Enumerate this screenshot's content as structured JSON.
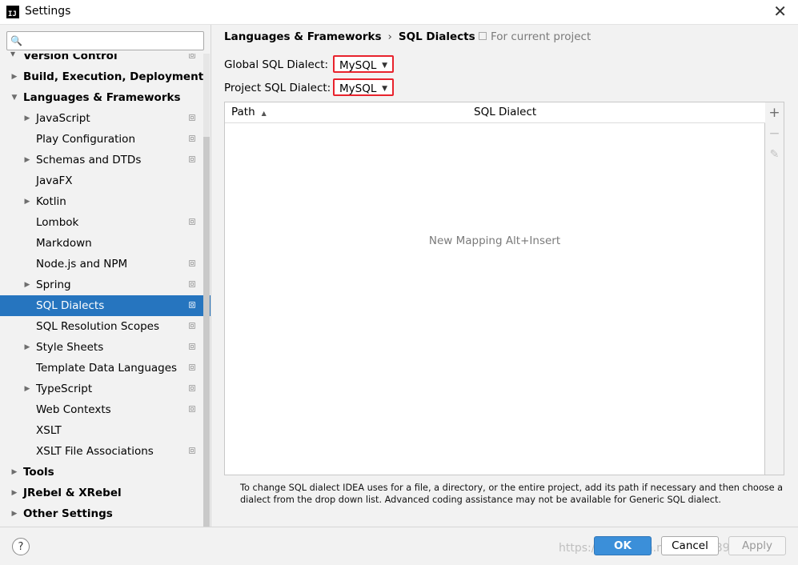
{
  "window": {
    "title": "Settings",
    "app_icon": "IJ",
    "close": "✕"
  },
  "search": {
    "icon": "search-icon",
    "placeholder": "",
    "value": ""
  },
  "tree": [
    {
      "label": "Version Control",
      "bold": true,
      "arrow": "",
      "indent": 0,
      "proj": true,
      "cut": true
    },
    {
      "label": "Build, Execution, Deployment",
      "bold": true,
      "arrow": "▶",
      "indent": 0,
      "proj": false
    },
    {
      "label": "Languages & Frameworks",
      "bold": true,
      "arrow": "▼",
      "indent": 0,
      "proj": false
    },
    {
      "label": "JavaScript",
      "arrow": "▶",
      "indent": 1,
      "proj": true
    },
    {
      "label": "Play Configuration",
      "arrow": "",
      "indent": 1,
      "proj": true
    },
    {
      "label": "Schemas and DTDs",
      "arrow": "▶",
      "indent": 1,
      "proj": true
    },
    {
      "label": "JavaFX",
      "arrow": "",
      "indent": 1,
      "proj": false
    },
    {
      "label": "Kotlin",
      "arrow": "▶",
      "indent": 1,
      "proj": false
    },
    {
      "label": "Lombok",
      "arrow": "",
      "indent": 1,
      "proj": true
    },
    {
      "label": "Markdown",
      "arrow": "",
      "indent": 1,
      "proj": false
    },
    {
      "label": "Node.js and NPM",
      "arrow": "",
      "indent": 1,
      "proj": true
    },
    {
      "label": "Spring",
      "arrow": "▶",
      "indent": 1,
      "proj": true
    },
    {
      "label": "SQL Dialects",
      "arrow": "",
      "indent": 1,
      "proj": true,
      "selected": true
    },
    {
      "label": "SQL Resolution Scopes",
      "arrow": "",
      "indent": 1,
      "proj": true
    },
    {
      "label": "Style Sheets",
      "arrow": "▶",
      "indent": 1,
      "proj": true
    },
    {
      "label": "Template Data Languages",
      "arrow": "",
      "indent": 1,
      "proj": true
    },
    {
      "label": "TypeScript",
      "arrow": "▶",
      "indent": 1,
      "proj": true
    },
    {
      "label": "Web Contexts",
      "arrow": "",
      "indent": 1,
      "proj": true
    },
    {
      "label": "XSLT",
      "arrow": "",
      "indent": 1,
      "proj": false
    },
    {
      "label": "XSLT File Associations",
      "arrow": "",
      "indent": 1,
      "proj": true
    },
    {
      "label": "Tools",
      "bold": true,
      "arrow": "▶",
      "indent": 0,
      "proj": false
    },
    {
      "label": "JRebel & XRebel",
      "bold": true,
      "arrow": "▶",
      "indent": 0,
      "proj": false
    },
    {
      "label": "Other Settings",
      "bold": true,
      "arrow": "▶",
      "indent": 0,
      "proj": false
    }
  ],
  "content": {
    "breadcrumb": {
      "parent": "Languages & Frameworks",
      "sep": "›",
      "current": "SQL Dialects"
    },
    "for_project": "For current project",
    "global_label": "Global SQL Dialect:",
    "global_value": "MySQL",
    "project_label": "Project SQL Dialect:",
    "project_value": "MySQL",
    "dropdown_icon": "▼",
    "table": {
      "col_path": "Path",
      "sort_icon": "▲",
      "col_dialect": "SQL Dialect",
      "empty": "New Mapping Alt+Insert"
    },
    "toolbar": {
      "add": "+",
      "remove": "−",
      "edit": "✎"
    },
    "hint": "To change SQL dialect IDEA uses for a file, a directory, or the entire project, add its path if necessary and then choose a dialect from the drop down list. Advanced coding assistance may not be available for Generic SQL dialect."
  },
  "footer": {
    "help": "?",
    "ok": "OK",
    "cancel": "Cancel",
    "apply": "Apply",
    "watermark": "https://blog.csdn.net/baidu_39201314"
  }
}
